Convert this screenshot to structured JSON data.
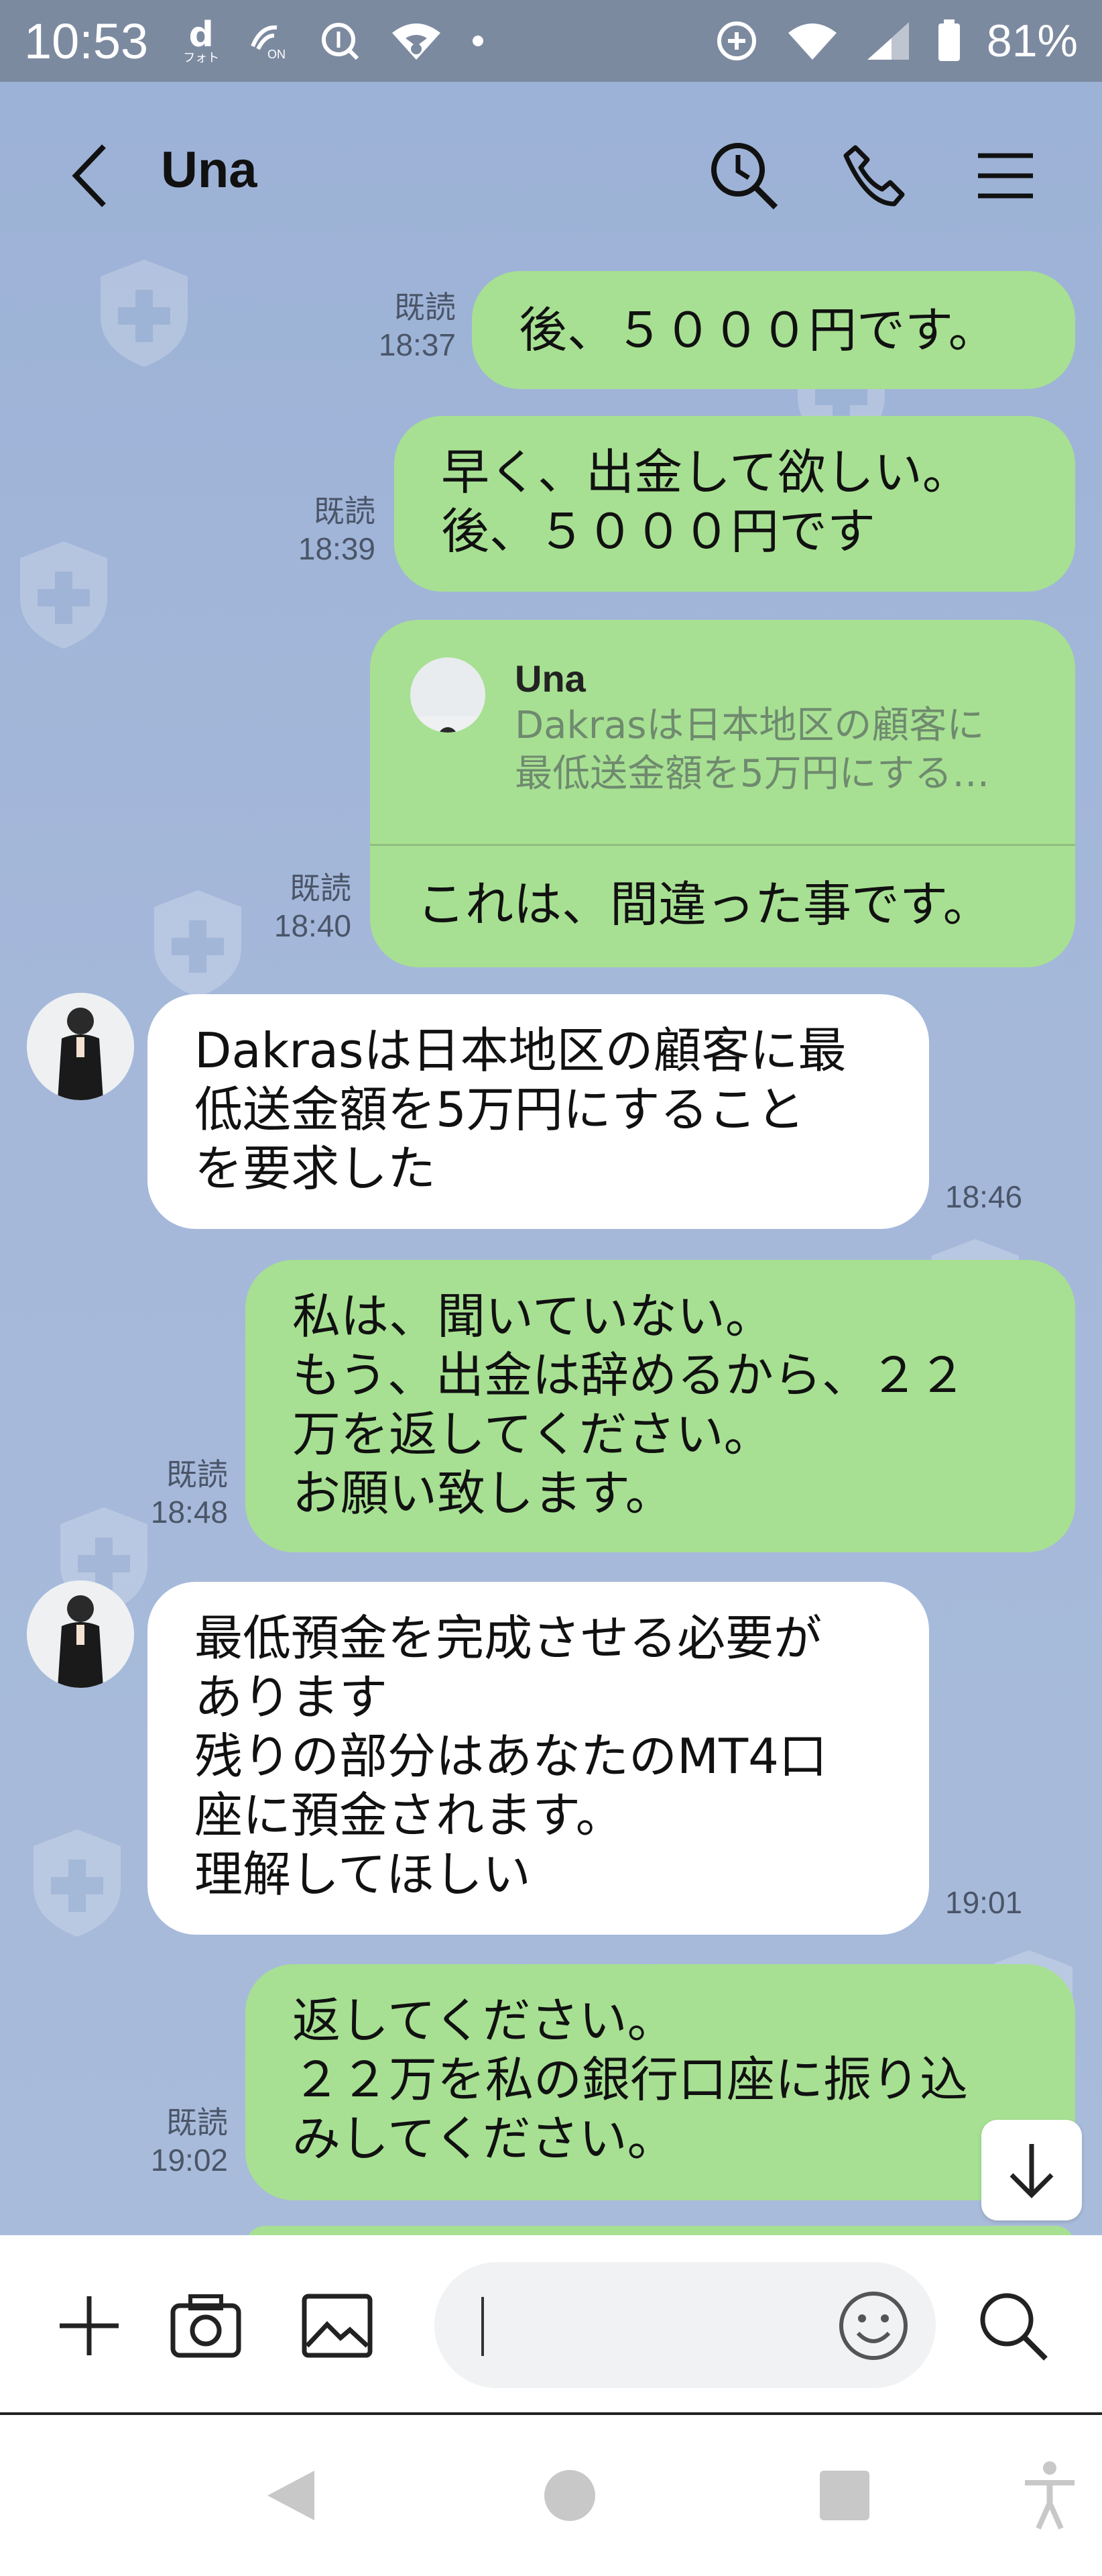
{
  "status_bar": {
    "time": "10:53",
    "battery": "81%",
    "icons": [
      "d-photo-icon",
      "nfc-on-icon",
      "vpn-search-icon",
      "wifi-icon",
      "dot-icon",
      "data-saver-icon",
      "wifi-4-icon",
      "signal-icon",
      "battery-icon"
    ],
    "d_label": "d",
    "d_sublabel": "フォト",
    "nfc_label": "ON"
  },
  "header": {
    "title": "Una"
  },
  "messages": [
    {
      "side": "right",
      "read": "既読",
      "time": "18:37",
      "text": "後、５０００円です。"
    },
    {
      "side": "right",
      "read": "既読",
      "time": "18:39",
      "text": "早く、出金して欲しい。\n後、５０００円です"
    },
    {
      "side": "right",
      "read": "既読",
      "time": "18:40",
      "reply_name": "Una",
      "reply_text": "Dakrasは日本地区の顧客に\n最低送金額を5万円にする…",
      "text": "これは、間違った事です。"
    },
    {
      "side": "left",
      "time": "18:46",
      "text": "Dakrasは日本地区の顧客に最\n低送金額を5万円にすること\nを要求した"
    },
    {
      "side": "right",
      "read": "既読",
      "time": "18:48",
      "text": "私は、聞いていない。\nもう、出金は辞めるから、２２\n万を返してください。\nお願い致します。"
    },
    {
      "side": "left",
      "time": "19:01",
      "text": "最低預金を完成させる必要が\nあります\n残りの部分はあなたのMT4口\n座に預金されます。\n理解してほしい"
    },
    {
      "side": "right",
      "read": "既読",
      "time": "19:02",
      "text": "返してください。\n２２万を私の銀行口座に振り込\nみしてください。"
    }
  ],
  "input_bar": {
    "placeholder": ""
  },
  "colors": {
    "bubble_green": "#a7e092",
    "bubble_white": "#ffffff",
    "chat_background": "#9eb4d4",
    "status_bar": "#7c8aa0"
  }
}
